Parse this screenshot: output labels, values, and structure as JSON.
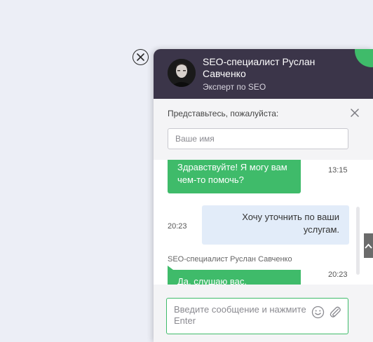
{
  "operator": {
    "name": "SEO-специалист Руслан Савченко",
    "role": "Эксперт по SEO"
  },
  "intro_form": {
    "label": "Представьтесь, пожалуйста:",
    "name_placeholder": "Ваше имя"
  },
  "messages": [
    {
      "from": "operator",
      "text": "Здравствуйте! Я могу вам чем-то помочь?",
      "time": "13:15"
    },
    {
      "from": "user",
      "text": "Хочу уточнить по ваши услугам.",
      "time": "20:23"
    },
    {
      "from": "operator",
      "sender": "SEO-специалист Руслан Савченко",
      "text": "Да, слушаю вас.",
      "time": "20:23"
    }
  ],
  "composer": {
    "placeholder": "Введите сообщение и нажмите Enter"
  },
  "colors": {
    "header": "#3b3549",
    "accent": "#3fbb6a",
    "user_bubble": "#e2ecf9",
    "background": "#eceef6"
  },
  "icons": {
    "close_widget": "close-circle-icon",
    "close_intro": "close-icon",
    "emoji": "emoji-icon",
    "attach": "paperclip-icon",
    "scroll_top": "chevron-up-icon"
  }
}
